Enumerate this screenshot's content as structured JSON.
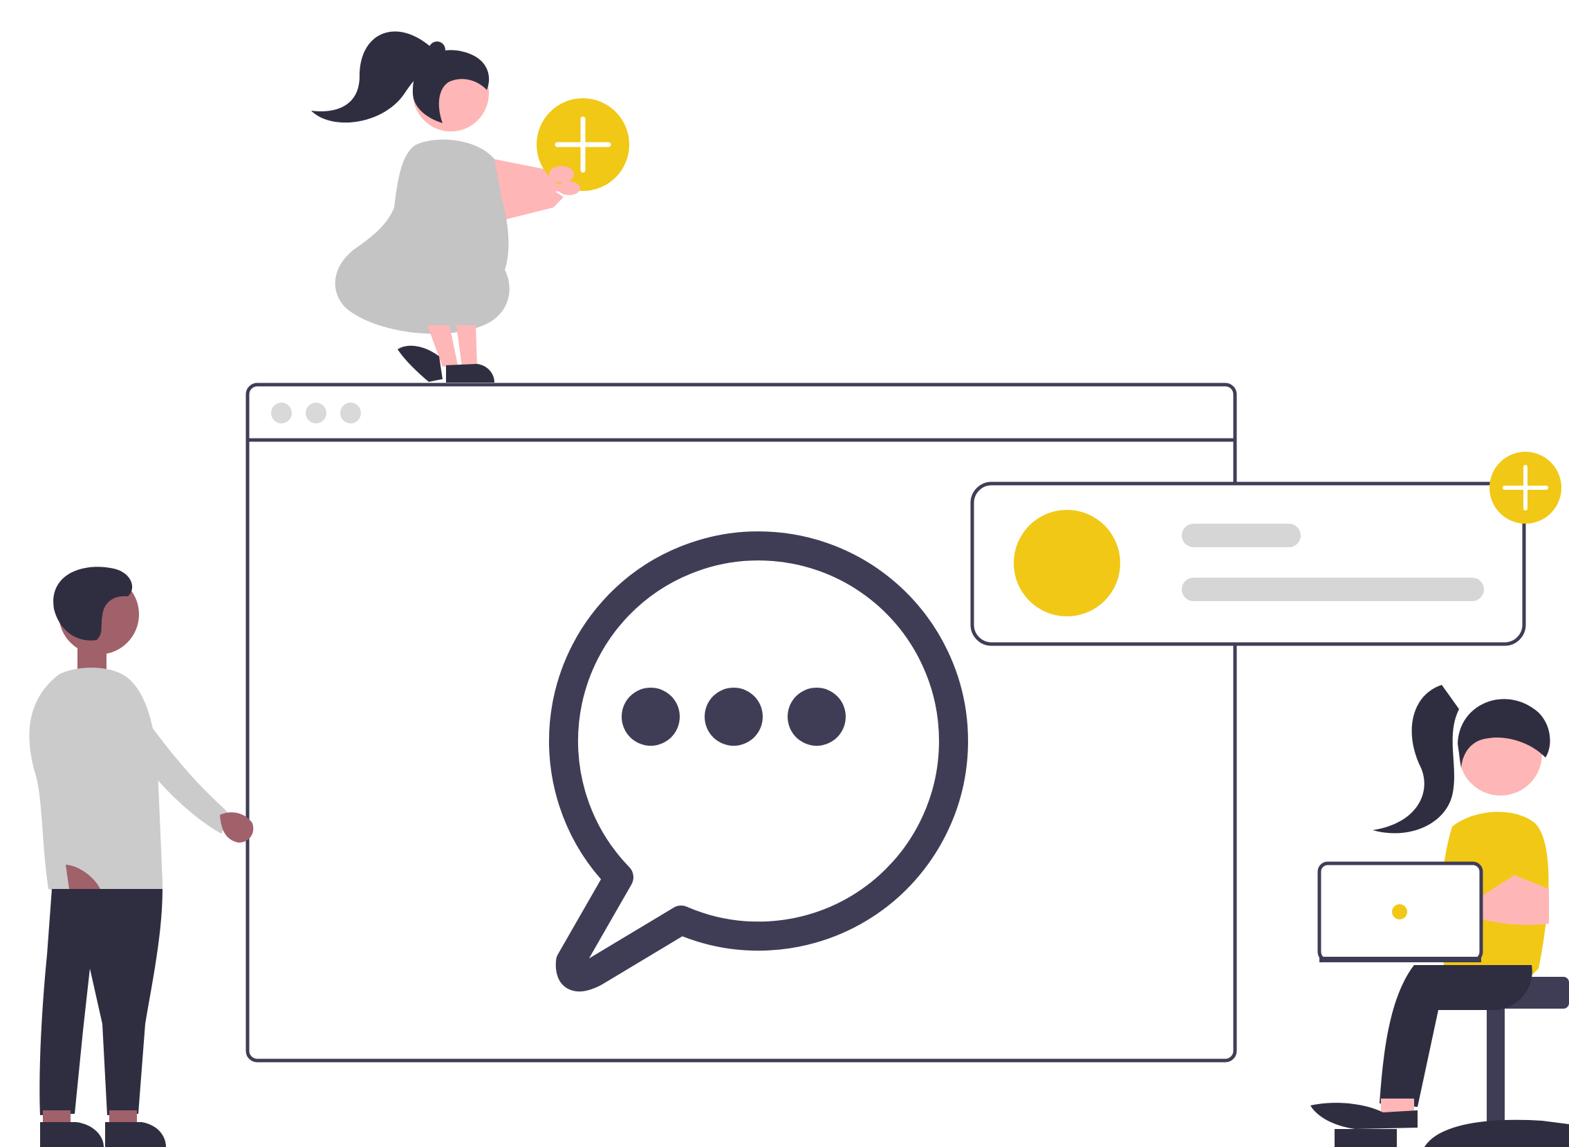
{
  "colors": {
    "background": "#ffffff",
    "outline": "#3f3d56",
    "dark": "#2f2e41",
    "accent_yellow": "#f1c816",
    "skin_pink": "#ffb6b6",
    "skin_dark": "#a0616a",
    "shirt_gray": "#cbcbcb",
    "dress_gray": "#c4c4c4",
    "placeholder_gray": "#d6d6d6",
    "window_dot_gray": "#d9d9d9",
    "plus_white": "#ffffff"
  },
  "illustration": {
    "browser_window": {
      "traffic_light_dots": 3
    },
    "chat_bubble": {
      "icon": "speech-bubble-icon",
      "typing_dots": 3
    },
    "notification_card": {
      "avatar_icon": "avatar-circle-icon",
      "placeholder_lines": 2,
      "badge_icon": "plus-icon"
    },
    "people": [
      {
        "role": "woman-crouching-on-window",
        "holds": "plus-icon"
      },
      {
        "role": "man-standing-left"
      },
      {
        "role": "woman-sitting-with-laptop-right"
      }
    ]
  }
}
